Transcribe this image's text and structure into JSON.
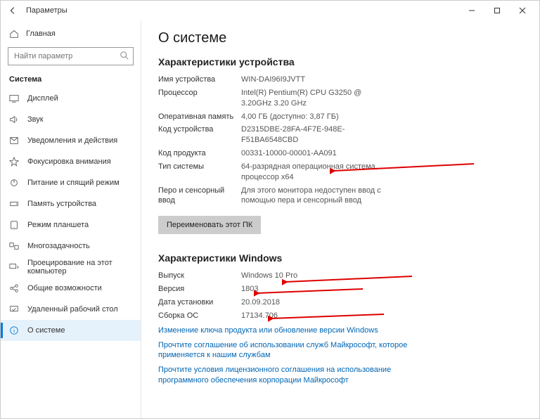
{
  "titlebar": {
    "title": "Параметры"
  },
  "home_label": "Главная",
  "search": {
    "placeholder": "Найти параметр"
  },
  "category": "Система",
  "nav": [
    {
      "label": "Дисплей"
    },
    {
      "label": "Звук"
    },
    {
      "label": "Уведомления и действия"
    },
    {
      "label": "Фокусировка внимания"
    },
    {
      "label": "Питание и спящий режим"
    },
    {
      "label": "Память устройства"
    },
    {
      "label": "Режим планшета"
    },
    {
      "label": "Многозадачность"
    },
    {
      "label": "Проецирование на этот компьютер"
    },
    {
      "label": "Общие возможности"
    },
    {
      "label": "Удаленный рабочий стол"
    },
    {
      "label": "О системе"
    }
  ],
  "page_title": "О системе",
  "device_specs_heading": "Характеристики устройства",
  "device": {
    "device_name_label": "Имя устройства",
    "device_name": "WIN-DAI96I9JVTT",
    "cpu_label": "Процессор",
    "cpu": "Intel(R) Pentium(R) CPU G3250 @ 3.20GHz   3.20 GHz",
    "ram_label": "Оперативная память",
    "ram": "4,00 ГБ (доступно: 3,87 ГБ)",
    "device_id_label": "Код устройства",
    "device_id": "D2315DBE-28FA-4F7E-948E-F51BA6548CBD",
    "product_id_label": "Код продукта",
    "product_id": "00331-10000-00001-AA091",
    "system_type_label": "Тип системы",
    "system_type": "64-разрядная операционная система, процессор x64",
    "pen_label": "Перо и сенсорный ввод",
    "pen": "Для этого монитора недоступен ввод с помощью пера и сенсорный ввод"
  },
  "rename_button": "Переименовать этот ПК",
  "windows_specs_heading": "Характеристики Windows",
  "win": {
    "edition_label": "Выпуск",
    "edition": "Windows 10 Pro",
    "version_label": "Версия",
    "version": "1803",
    "installed_label": "Дата установки",
    "installed": "20.09.2018",
    "build_label": "Сборка ОС",
    "build": "17134.706"
  },
  "links": {
    "product_key": "Изменение ключа продукта или обновление версии Windows",
    "services_agreement": "Прочтите соглашение об использовании служб Майкрософт, которое применяется к нашим службам",
    "license_terms": "Прочтите условия лицензионного соглашения на использование программного обеспечения корпорации Майкрософт"
  }
}
